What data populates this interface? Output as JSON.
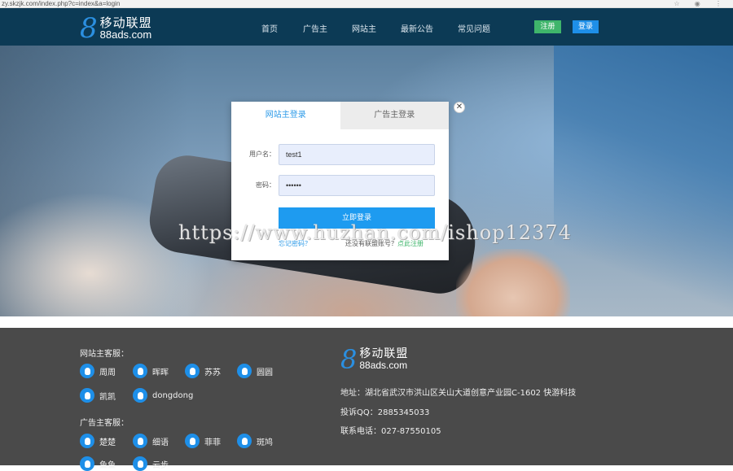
{
  "browser": {
    "url": "zy.skzjk.com/index.php?c=index&a=login"
  },
  "nav": {
    "logo_cn": "移动联盟",
    "logo_en": "88ads.com",
    "logo_mark": "8",
    "menu": [
      "首页",
      "广告主",
      "网站主",
      "最新公告",
      "常见问题"
    ],
    "register": "注册",
    "login": "登录"
  },
  "modal": {
    "tab_site": "网站主登录",
    "tab_adv": "广告主登录",
    "close": "✕",
    "username_label": "用户名：",
    "username_value": "test1",
    "password_label": "密码：",
    "password_value": "••••••",
    "submit": "立即登录",
    "forgot": "忘记密码？",
    "no_account": "还没有联盟账号？",
    "register_link": "点此注册"
  },
  "watermark": "https://www.huzhan.com/ishop12374",
  "footer": {
    "site_service_title": "网站主客服：",
    "site_service": [
      "周周",
      "晖晖",
      "苏苏",
      "圆圆",
      "凯凯",
      "dongdong"
    ],
    "adv_service_title": "广告主客服：",
    "adv_service": [
      "楚楚",
      "细语",
      "菲菲",
      "斑鸠",
      "鱼鱼",
      "云步"
    ],
    "logo_cn": "移动联盟",
    "logo_en": "88ads.com",
    "logo_mark": "8",
    "address": "地址：湖北省武汉市洪山区关山大道创意产业园C-1602 快游科技",
    "complaint_qq": "投诉QQ：2885345033",
    "phone": "联系电话：027-87550105"
  },
  "colors": {
    "nav_bg": "#0c3a55",
    "accent": "#1e9bf0",
    "register": "#3fb56b",
    "footer_bg": "#4a4a4a"
  }
}
